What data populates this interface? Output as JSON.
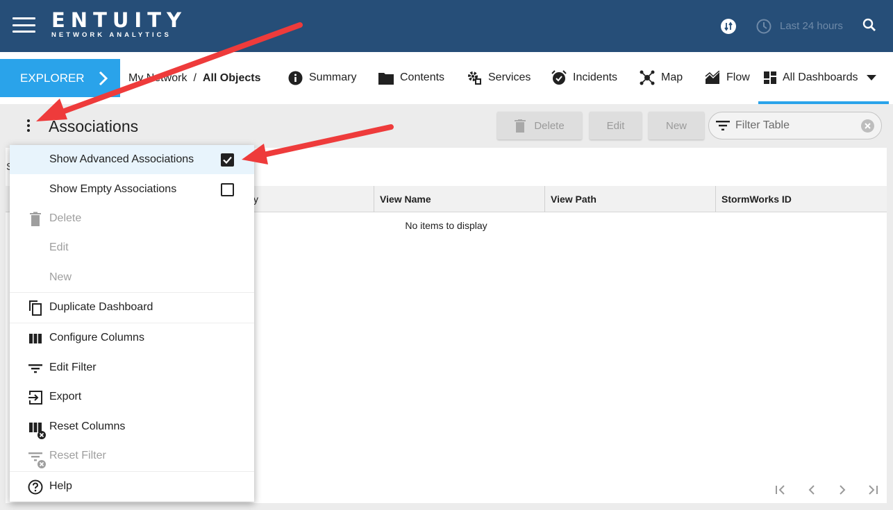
{
  "topbar": {
    "brand_title": "ENTUITY",
    "brand_subtitle": "NETWORK ANALYTICS",
    "time_range": "Last 24 hours",
    "colors": {
      "background": "#264e78",
      "accent": "#2aa3ea"
    }
  },
  "nav": {
    "explorer_label": "EXPLORER",
    "breadcrumb": [
      "My Network",
      "All Objects"
    ],
    "breadcrumb_separator": "/",
    "tabs": [
      {
        "label": "Summary",
        "icon": "info-icon"
      },
      {
        "label": "Contents",
        "icon": "folder-icon"
      },
      {
        "label": "Services",
        "icon": "services-icon"
      },
      {
        "label": "Incidents",
        "icon": "alarm-clock-icon"
      },
      {
        "label": "Map",
        "icon": "topology-icon"
      },
      {
        "label": "Flow",
        "icon": "area-chart-icon"
      },
      {
        "label": "All Dashboards",
        "icon": "dashboard-icon",
        "active": true
      }
    ]
  },
  "page": {
    "title": "Associations",
    "delete_label": "Delete",
    "edit_label": "Edit",
    "new_label": "New",
    "filter_placeholder": "Filter Table"
  },
  "table": {
    "row_prefix": "S",
    "partial_header": "y",
    "columns": [
      "View Name",
      "View Path",
      "StormWorks ID"
    ],
    "empty_message": "No items to display"
  },
  "menu": {
    "items": [
      {
        "label": "Show Advanced Associations",
        "checked": true
      },
      {
        "label": "Show Empty Associations",
        "checked": false
      },
      {
        "label": "Delete",
        "icon": "trash-icon",
        "disabled": true
      },
      {
        "label": "Edit",
        "disabled": true
      },
      {
        "label": "New",
        "disabled": true
      },
      {
        "label": "Duplicate Dashboard",
        "icon": "copy-icon"
      },
      {
        "label": "Configure Columns",
        "icon": "columns-icon"
      },
      {
        "label": "Edit Filter",
        "icon": "filter-icon"
      },
      {
        "label": "Export",
        "icon": "export-icon"
      },
      {
        "label": "Reset Columns",
        "icon": "reset-columns-icon"
      },
      {
        "label": "Reset Filter",
        "icon": "reset-filter-icon",
        "disabled": true
      },
      {
        "label": "Help",
        "icon": "help-icon"
      }
    ]
  }
}
